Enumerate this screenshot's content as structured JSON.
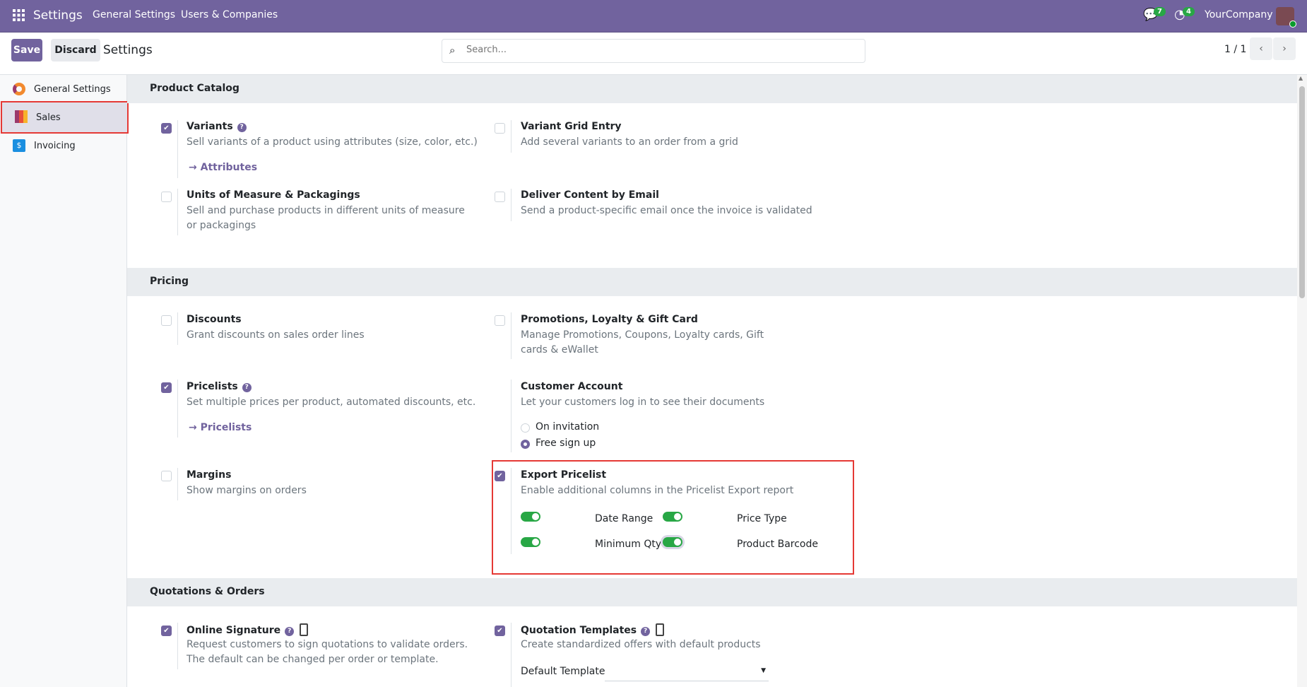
{
  "topbar": {
    "app": "Settings",
    "menu": [
      "General Settings",
      "Users & Companies"
    ],
    "messages_count": "7",
    "activities_count": "4",
    "company": "YourCompany"
  },
  "control": {
    "save": "Save",
    "discard": "Discard",
    "title": "Settings",
    "search_placeholder": "Search...",
    "pager": "1 / 1"
  },
  "sidebar": {
    "items": [
      {
        "label": "General Settings"
      },
      {
        "label": "Sales"
      },
      {
        "label": "Invoicing"
      }
    ]
  },
  "sections": {
    "catalog": {
      "title": "Product Catalog",
      "variants": {
        "title": "Variants",
        "desc": "Sell variants of a product using attributes (size, color, etc.)",
        "link": "Attributes",
        "checked": true
      },
      "grid": {
        "title": "Variant Grid Entry",
        "desc": "Add several variants to an order from a grid",
        "checked": false
      },
      "uom": {
        "title": "Units of Measure & Packagings",
        "desc": "Sell and purchase products in different units of measure or packagings",
        "checked": false
      },
      "email": {
        "title": "Deliver Content by Email",
        "desc": "Send a product-specific email once the invoice is validated",
        "checked": false
      }
    },
    "pricing": {
      "title": "Pricing",
      "discounts": {
        "title": "Discounts",
        "desc": "Grant discounts on sales order lines",
        "checked": false
      },
      "promos": {
        "title": "Promotions, Loyalty & Gift Card",
        "desc": "Manage Promotions, Coupons, Loyalty cards, Gift cards & eWallet",
        "checked": false
      },
      "pricelists": {
        "title": "Pricelists",
        "desc": "Set multiple prices per product, automated discounts, etc.",
        "link": "Pricelists",
        "checked": true
      },
      "account": {
        "title": "Customer Account",
        "desc": "Let your customers log in to see their documents",
        "options": [
          "On invitation",
          "Free sign up"
        ],
        "selected": "Free sign up"
      },
      "margins": {
        "title": "Margins",
        "desc": "Show margins on orders",
        "checked": false
      },
      "export": {
        "title": "Export Pricelist",
        "desc": "Enable additional columns in the Pricelist Export report",
        "checked": true,
        "toggles": [
          {
            "label": "Date Range",
            "on": true
          },
          {
            "label": "Price Type",
            "on": true
          },
          {
            "label": "Minimum Qty",
            "on": true
          },
          {
            "label": "Product Barcode",
            "on": true
          }
        ]
      }
    },
    "quotations": {
      "title": "Quotations & Orders",
      "signature": {
        "title": "Online Signature",
        "desc": "Request customers to sign quotations to validate orders. The default can be changed per order or template.",
        "checked": true
      },
      "templates": {
        "title": "Quotation Templates",
        "desc": "Create standardized offers with default products",
        "field_label": "Default Template",
        "field_value": "",
        "checked": true
      }
    }
  }
}
